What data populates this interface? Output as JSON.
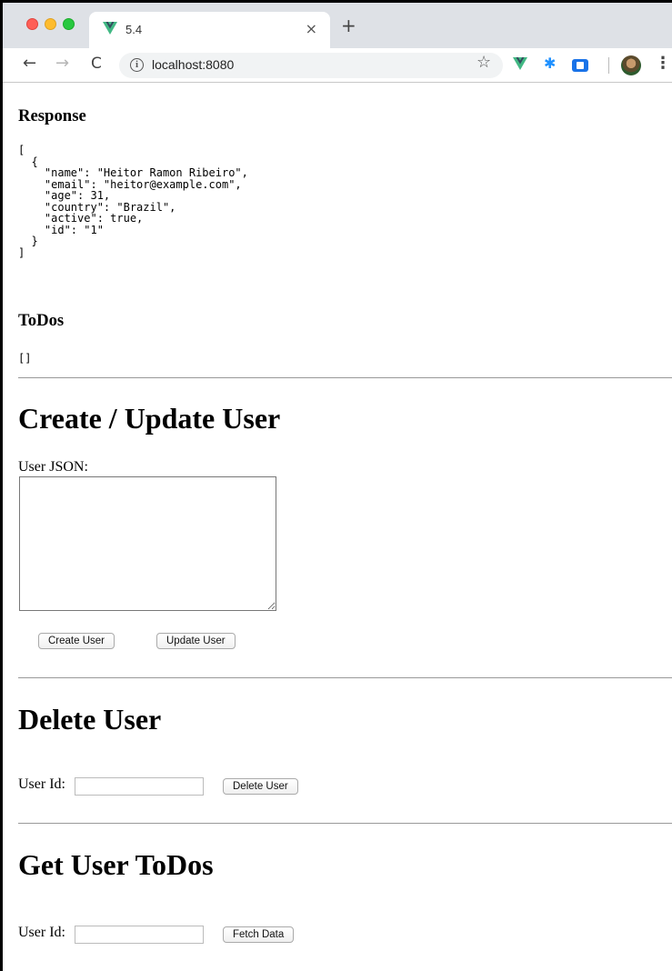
{
  "browser": {
    "tab_title": "5.4",
    "tab_close": "×",
    "new_tab": "+",
    "url": "localhost:8080",
    "nav_back": "←",
    "nav_forward": "→",
    "reload": "C",
    "star": "☆",
    "info": "i",
    "menu": "⋮"
  },
  "response": {
    "heading": "Response",
    "json": "[\n  {\n    \"name\": \"Heitor Ramon Ribeiro\",\n    \"email\": \"heitor@example.com\",\n    \"age\": 31,\n    \"country\": \"Brazil\",\n    \"active\": true,\n    \"id\": \"1\"\n  }\n]"
  },
  "todos": {
    "heading": "ToDos",
    "json": "[]"
  },
  "create_update": {
    "heading": "Create / Update User",
    "label": "User JSON:",
    "textarea_value": "",
    "create_button": "Create User",
    "update_button": "Update User"
  },
  "delete": {
    "heading": "Delete User",
    "label": "User Id:",
    "input_value": "",
    "button": "Delete User"
  },
  "get_todos": {
    "heading": "Get User ToDos",
    "label": "User Id:",
    "input_value": "",
    "button": "Fetch Data"
  },
  "colors": {
    "vue_green": "#41b883",
    "vue_dark": "#34495e",
    "tabstrip_bg": "#dee1e6"
  },
  "icons": [
    "vue-logo-icon",
    "info-icon",
    "star-icon",
    "bug-icon",
    "extension-icon",
    "avatar",
    "menu-dots-icon"
  ]
}
